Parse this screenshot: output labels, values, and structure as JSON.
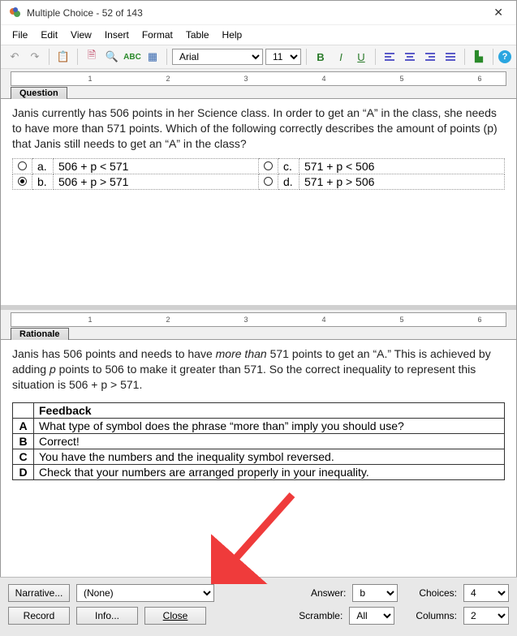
{
  "window": {
    "title": "Multiple Choice - 52 of 143"
  },
  "menu": {
    "items": [
      "File",
      "Edit",
      "View",
      "Insert",
      "Format",
      "Table",
      "Help"
    ]
  },
  "toolbar": {
    "font_name": "Arial",
    "font_size": "11"
  },
  "tabs": {
    "question": "Question",
    "rationale": "Rationale"
  },
  "question": {
    "text": "Janis currently has 506 points in her Science class. In order to get an “A” in the class, she needs to have more than 571 points. Which of the following correctly describes the amount of points (p) that Janis still needs to get an “A” in the class?",
    "options": [
      {
        "letter": "a.",
        "text": "506 + p < 571",
        "selected": false
      },
      {
        "letter": "b.",
        "text": "506 + p > 571",
        "selected": true
      },
      {
        "letter": "c.",
        "text": "571 + p < 506",
        "selected": false
      },
      {
        "letter": "d.",
        "text": "571 + p > 506",
        "selected": false
      }
    ]
  },
  "rationale": {
    "text_pre": "Janis has 506 points and needs to have ",
    "text_em": "more than",
    "text_mid": " 571 points to get an “A.” This is achieved by adding ",
    "text_p": "p",
    "text_post": " points to 506 to make it greater than 571. So the correct inequality to represent this situation is 506 + p > 571.",
    "feedback_header": "Feedback",
    "feedback": [
      {
        "key": "A",
        "text": "What type of symbol does the phrase “more than” imply you should use?"
      },
      {
        "key": "B",
        "text": "Correct!"
      },
      {
        "key": "C",
        "text": "You have the numbers and the inequality symbol reversed."
      },
      {
        "key": "D",
        "text": "Check that your numbers are arranged properly in your inequality."
      }
    ]
  },
  "bottom": {
    "narrative_btn": "Narrative...",
    "narrative_val": "(None)",
    "record_btn": "Record",
    "info_btn": "Info...",
    "close_btn": "Close",
    "answer_lbl": "Answer:",
    "answer_val": "b",
    "choices_lbl": "Choices:",
    "choices_val": "4",
    "scramble_lbl": "Scramble:",
    "scramble_val": "All",
    "columns_lbl": "Columns:",
    "columns_val": "2"
  }
}
